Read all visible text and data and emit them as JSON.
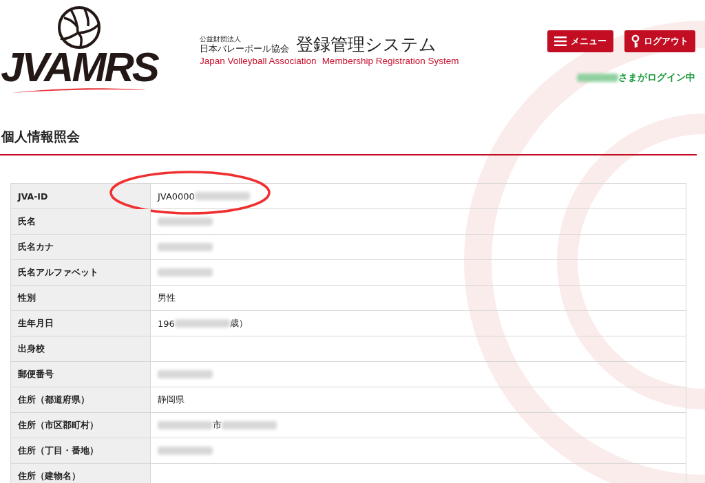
{
  "header": {
    "logo_text": "JVAMRS",
    "org_kind": "公益財団法人",
    "org_name": "日本バレーボール協会",
    "system_name": "登録管理システム",
    "org_name_en": "Japan Volleyball Association",
    "system_name_en": "Membership Registration System",
    "buttons": [
      {
        "kind": "menu",
        "label": "メニュー"
      },
      {
        "kind": "logout",
        "label": "ログアウト"
      }
    ],
    "login_status": [
      {
        "kind": "blur"
      },
      {
        "kind": "text",
        "text": "さまがログイン中"
      }
    ]
  },
  "page_title": "個人情報照会",
  "rows": [
    {
      "label": "JVA-ID",
      "circled": true,
      "value": [
        {
          "kind": "text",
          "text": "JVA0000"
        },
        {
          "kind": "blur"
        }
      ]
    },
    {
      "label": "氏名",
      "circled": false,
      "value": [
        {
          "kind": "blur"
        }
      ]
    },
    {
      "label": "氏名カナ",
      "circled": false,
      "value": [
        {
          "kind": "blur"
        }
      ]
    },
    {
      "label": "氏名アルファベット",
      "circled": false,
      "value": [
        {
          "kind": "blur"
        }
      ]
    },
    {
      "label": "性別",
      "circled": false,
      "value": [
        {
          "kind": "text",
          "text": "男性"
        }
      ]
    },
    {
      "label": "生年月日",
      "circled": false,
      "value": [
        {
          "kind": "text",
          "text": "196"
        },
        {
          "kind": "blur"
        },
        {
          "kind": "text",
          "text": "歳）"
        }
      ]
    },
    {
      "label": "出身校",
      "circled": false,
      "value": []
    },
    {
      "label": "郵便番号",
      "circled": false,
      "value": [
        {
          "kind": "blur"
        }
      ]
    },
    {
      "label": "住所（都道府県）",
      "circled": false,
      "value": [
        {
          "kind": "text",
          "text": "静岡県"
        }
      ]
    },
    {
      "label": "住所（市区郡町村）",
      "circled": false,
      "value": [
        {
          "kind": "blur"
        },
        {
          "kind": "text",
          "text": "市"
        },
        {
          "kind": "blur"
        }
      ]
    },
    {
      "label": "住所（丁目・番地）",
      "circled": false,
      "value": [
        {
          "kind": "blur"
        }
      ]
    },
    {
      "label": "住所（建物名）",
      "circled": false,
      "value": []
    }
  ]
}
